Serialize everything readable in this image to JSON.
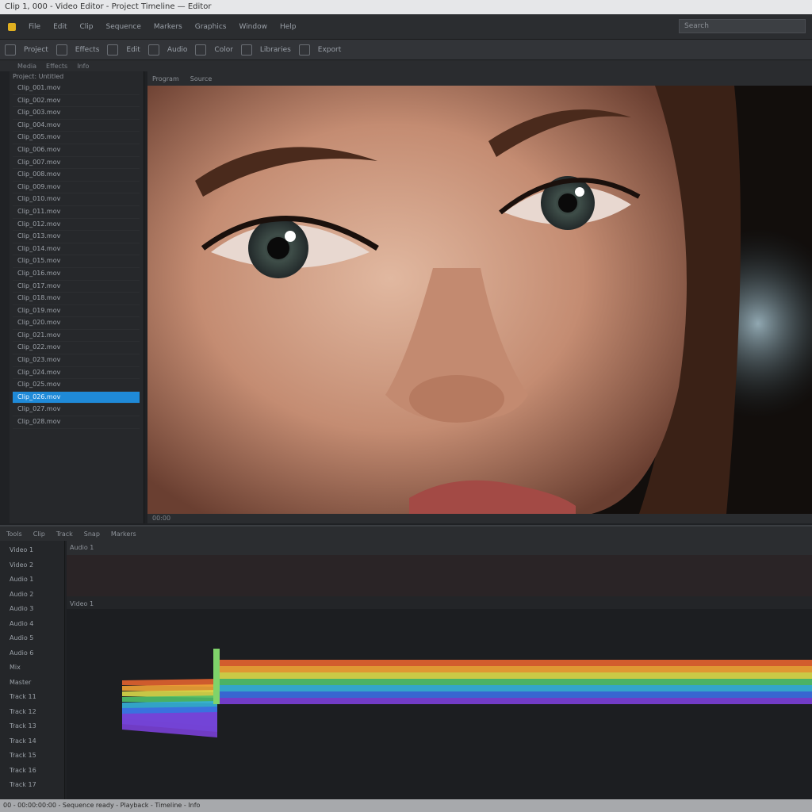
{
  "window": {
    "title": "Clip 1, 000 - Video Editor - Project Timeline — Editor"
  },
  "menubar": {
    "items": [
      "File",
      "Edit",
      "Clip",
      "Sequence",
      "Markers",
      "Graphics",
      "Window",
      "Help"
    ],
    "search_placeholder": "Search"
  },
  "toolbar": {
    "items": [
      "Project",
      "Effects",
      "Edit",
      "Audio",
      "Color",
      "Libraries",
      "Export"
    ]
  },
  "subtabs": [
    "Media",
    "Effects",
    "Info"
  ],
  "left_panel": {
    "header": "Project: Untitled",
    "items": [
      "Clip_001.mov",
      "Clip_002.mov",
      "Clip_003.mov",
      "Clip_004.mov",
      "Clip_005.mov",
      "Clip_006.mov",
      "Clip_007.mov",
      "Clip_008.mov",
      "Clip_009.mov",
      "Clip_010.mov",
      "Clip_011.mov",
      "Clip_012.mov",
      "Clip_013.mov",
      "Clip_014.mov",
      "Clip_015.mov",
      "Clip_016.mov",
      "Clip_017.mov",
      "Clip_018.mov",
      "Clip_019.mov",
      "Clip_020.mov",
      "Clip_021.mov",
      "Clip_022.mov",
      "Clip_023.mov",
      "Clip_024.mov",
      "Clip_025.mov",
      "Clip_026.mov",
      "Clip_027.mov",
      "Clip_028.mov"
    ],
    "selected_index": 25
  },
  "viewer": {
    "tabs": [
      "Program",
      "Source"
    ],
    "footer": "00:00"
  },
  "timeline": {
    "toolbar": [
      "Tools",
      "Clip",
      "Track",
      "Snap",
      "Markers"
    ],
    "header": "Audio 1",
    "sub_header": "Video 1",
    "tracks": [
      "Video 1",
      "Video 2",
      "Audio 1",
      "Audio 2",
      "Audio 3",
      "Audio 4",
      "Audio 5",
      "Audio 6",
      "Mix",
      "Master",
      "Track 11",
      "Track 12",
      "Track 13",
      "Track 14",
      "Track 15",
      "Track 16",
      "Track 17"
    ]
  },
  "statusbar": {
    "text": "00 - 00:00:00:00 - Sequence ready - Playback - Timeline - Info"
  },
  "colors": {
    "accent": "#1f8ad8",
    "panel": "#26282b",
    "background": "#1f2124",
    "status_bar": "#a7a9ac",
    "spectrum": [
      "#e2622f",
      "#f0a235",
      "#d9d84a",
      "#4fbf6a",
      "#35b1d8",
      "#3b6ce0",
      "#7a3fd6"
    ]
  },
  "icons": [
    "app-icon",
    "search-icon",
    "tool-icon"
  ]
}
